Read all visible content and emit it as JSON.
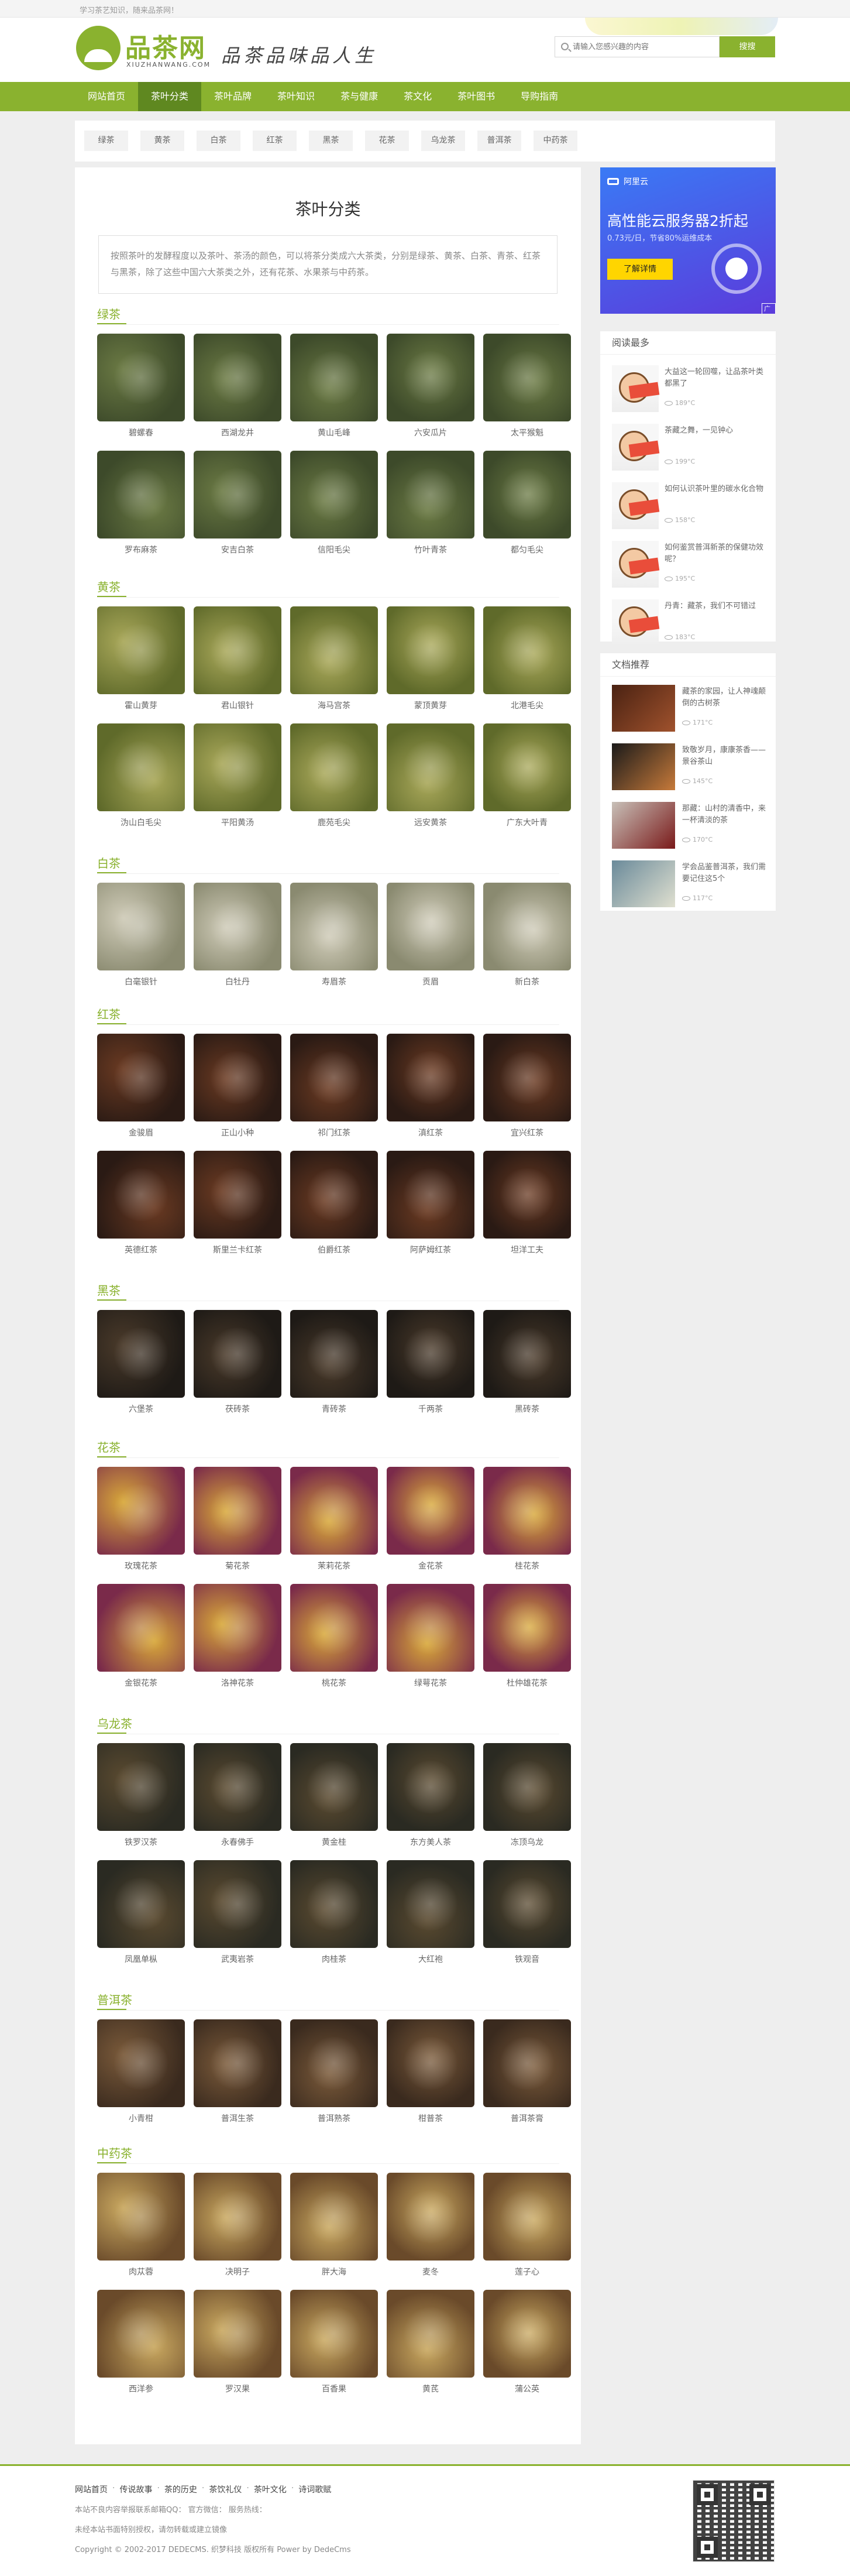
{
  "topbar": {
    "slogan": "学习茶艺知识，随来品茶网！"
  },
  "header": {
    "logo_text": "品茶网",
    "logo_domain": "XIUZHANWANG.COM",
    "motto": "品茶品味品人生",
    "search_placeholder": "请输入您感兴趣的内容",
    "search_button": "搜搜"
  },
  "nav": {
    "items": [
      {
        "label": "网站首页",
        "active": false
      },
      {
        "label": "茶叶分类",
        "active": true
      },
      {
        "label": "茶叶品牌",
        "active": false
      },
      {
        "label": "茶叶知识",
        "active": false
      },
      {
        "label": "茶与健康",
        "active": false
      },
      {
        "label": "茶文化",
        "active": false
      },
      {
        "label": "茶叶图书",
        "active": false
      },
      {
        "label": "导购指南",
        "active": false
      }
    ]
  },
  "subnav": {
    "items": [
      "绿茶",
      "黄茶",
      "白茶",
      "红茶",
      "黑茶",
      "花茶",
      "乌龙茶",
      "普洱茶",
      "中药茶"
    ]
  },
  "main": {
    "title": "茶叶分类",
    "intro": "按照茶叶的发酵程度以及茶叶、茶汤的颜色，可以将茶分类成六大茶类，分别是绿茶、黄茶、白茶、青茶、红茶与黑茶，除了这些中国六大茶类之外，还有花茶、水果茶与中药茶。",
    "sections": [
      {
        "title": "绿茶",
        "items": [
          "碧螺春",
          "西湖龙井",
          "黄山毛峰",
          "六安瓜片",
          "太平猴魁",
          "罗布麻茶",
          "安吉白茶",
          "信阳毛尖",
          "竹叶青茶",
          "都匀毛尖"
        ]
      },
      {
        "title": "黄茶",
        "items": [
          "霍山黄芽",
          "君山银针",
          "海马宫茶",
          "蒙顶黄芽",
          "北港毛尖",
          "沩山白毛尖",
          "平阳黄汤",
          "鹿苑毛尖",
          "远安黄茶",
          "广东大叶青"
        ]
      },
      {
        "title": "白茶",
        "items": [
          "白毫银针",
          "白牡丹",
          "寿眉茶",
          "贡眉",
          "新白茶"
        ]
      },
      {
        "title": "红茶",
        "items": [
          "金骏眉",
          "正山小种",
          "祁门红茶",
          "滇红茶",
          "宜兴红茶",
          "英德红茶",
          "斯里兰卡红茶",
          "伯爵红茶",
          "阿萨姆红茶",
          "坦洋工夫"
        ]
      },
      {
        "title": "黑茶",
        "items": [
          "六堡茶",
          "茯砖茶",
          "青砖茶",
          "千两茶",
          "黑砖茶"
        ]
      },
      {
        "title": "花茶",
        "items": [
          "玫瑰花茶",
          "菊花茶",
          "茉莉花茶",
          "金花茶",
          "桂花茶",
          "金银花茶",
          "洛神花茶",
          "桃花茶",
          "绿萼花茶",
          "杜仲雄花茶"
        ]
      },
      {
        "title": "乌龙茶",
        "items": [
          "铁罗汉茶",
          "永春佛手",
          "黄金桂",
          "东方美人茶",
          "冻顶乌龙",
          "凤凰单枞",
          "武夷岩茶",
          "肉桂茶",
          "大红袍",
          "铁观音"
        ]
      },
      {
        "title": "普洱茶",
        "items": [
          "小青柑",
          "普洱生茶",
          "普洱熟茶",
          "柑普茶",
          "普洱茶膏"
        ]
      },
      {
        "title": "中药茶",
        "items": [
          "肉苁蓉",
          "决明子",
          "胖大海",
          "麦冬",
          "莲子心",
          "西洋参",
          "罗汉果",
          "百香果",
          "黄芪",
          "蒲公英"
        ]
      }
    ]
  },
  "sidebar": {
    "ad": {
      "brand": "阿里云",
      "headline": "高性能云服务器2折起",
      "sub": "0.73元/日，节省80%运维成本",
      "cta": "了解详情",
      "tag": "广告"
    },
    "reading": {
      "title": "阅读最多",
      "items": [
        {
          "title": "大益这一轮回噬，让品茶叶类都黑了",
          "views": "189°C"
        },
        {
          "title": "茶藏之舞，一见钟心",
          "views": "199°C"
        },
        {
          "title": "如何认识茶叶里的碳水化合物",
          "views": "158°C"
        },
        {
          "title": "如何鉴赏普洱新茶的保健功效呢？",
          "views": "195°C"
        },
        {
          "title": "丹青：藏茶，我们不可错过",
          "views": "183°C"
        }
      ]
    },
    "docs": {
      "title": "文档推荐",
      "items": [
        {
          "title": "藏茶的家园，让人神魂颠倒的古树茶",
          "views": "171°C"
        },
        {
          "title": "致敬岁月，康康茶香——景谷茶山",
          "views": "145°C"
        },
        {
          "title": "那藏：山村的清香中，来一杯清淡的茶",
          "views": "170°C"
        },
        {
          "title": "学会品鉴普洱茶，我们需要记住这5个",
          "views": "117°C"
        }
      ]
    }
  },
  "footer": {
    "links": [
      "网站首页",
      "传说故事",
      "茶的历史",
      "茶饮礼仪",
      "茶叶文化",
      "诗词歌赋"
    ],
    "line1": "本站不良内容举报联系邮箱QQ：  官方微信：  服务热线：",
    "line2": "未经本站书面特别授权，请勿转载或建立镜像",
    "line3": "Copyright © 2002-2017 DEDECMS. 织梦科技 版权所有  Power by DedeCms"
  },
  "colors": {
    "accent": "#8ab22f",
    "nav_active": "#5f8820",
    "background": "#eeeeee"
  }
}
